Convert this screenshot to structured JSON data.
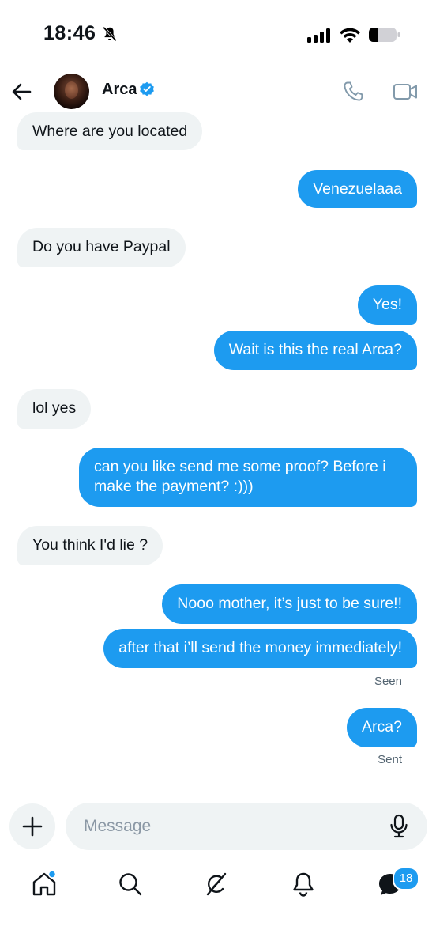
{
  "status_bar": {
    "time": "18:46",
    "icons": [
      "bell-slash-icon",
      "cellular-signal-icon",
      "wifi-icon",
      "battery-icon"
    ]
  },
  "header": {
    "contact_name": "Arca",
    "verified": true,
    "icons": [
      "back-arrow-icon",
      "phone-icon",
      "video-camera-icon"
    ]
  },
  "messages": [
    {
      "direction": "in",
      "text": "Where are you located"
    },
    {
      "direction": "out",
      "text": "Venezuelaaa"
    },
    {
      "direction": "in",
      "text": "Do you have Paypal"
    },
    {
      "direction": "out",
      "text": "Yes!"
    },
    {
      "direction": "out",
      "text": "Wait is this the real Arca?"
    },
    {
      "direction": "in",
      "text": "lol yes"
    },
    {
      "direction": "out",
      "text": "can you like send me some proof? Before i make the payment? :)))"
    },
    {
      "direction": "in",
      "text": "You think I'd lie ?"
    },
    {
      "direction": "out",
      "text": "Nooo mother, it’s just to be sure!!"
    },
    {
      "direction": "out",
      "text": "after that i’ll send the money immediately!"
    },
    {
      "direction": "out",
      "text": "Arca?"
    }
  ],
  "receipts": {
    "seen": "Seen",
    "sent": "Sent"
  },
  "composer": {
    "placeholder": "Message",
    "value": "",
    "icons": [
      "plus-icon",
      "microphone-icon"
    ]
  },
  "tabbar": {
    "items": [
      "home-icon",
      "search-icon",
      "grok-icon",
      "notifications-bell-icon",
      "messages-icon"
    ],
    "messages_badge": "18",
    "home_has_dot": true
  },
  "colors": {
    "accent": "#1d9bf0",
    "incoming_bubble": "#eff3f4",
    "text": "#0f1419",
    "secondary_text": "#536471"
  }
}
